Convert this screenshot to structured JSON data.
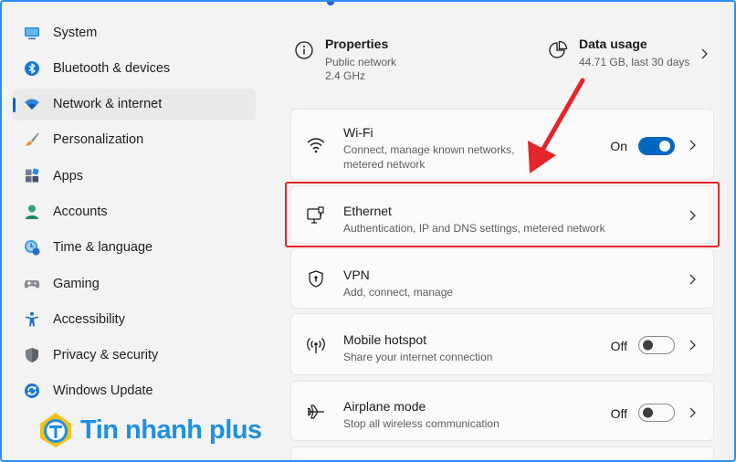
{
  "sidebar": {
    "items": [
      {
        "label": "System",
        "icon": "monitor-icon"
      },
      {
        "label": "Bluetooth & devices",
        "icon": "bluetooth-icon"
      },
      {
        "label": "Network & internet",
        "icon": "wifi-icon",
        "active": true
      },
      {
        "label": "Personalization",
        "icon": "brush-icon"
      },
      {
        "label": "Apps",
        "icon": "apps-icon"
      },
      {
        "label": "Accounts",
        "icon": "person-icon"
      },
      {
        "label": "Time & language",
        "icon": "clock-globe-icon"
      },
      {
        "label": "Gaming",
        "icon": "gamepad-icon"
      },
      {
        "label": "Accessibility",
        "icon": "accessibility-icon"
      },
      {
        "label": "Privacy & security",
        "icon": "shield-icon"
      },
      {
        "label": "Windows Update",
        "icon": "update-icon"
      }
    ]
  },
  "properties": {
    "title": "Properties",
    "line1": "Public network",
    "line2": "2.4 GHz"
  },
  "data_usage": {
    "title": "Data usage",
    "sub": "44.71 GB, last 30 days"
  },
  "cards": {
    "wifi": {
      "title": "Wi-Fi",
      "sub1": "Connect, manage known networks,",
      "sub2": "metered network",
      "state": "On",
      "toggle_on": true
    },
    "ethernet": {
      "title": "Ethernet",
      "sub": "Authentication, IP and DNS settings, metered network"
    },
    "vpn": {
      "title": "VPN",
      "sub": "Add, connect, manage"
    },
    "hotspot": {
      "title": "Mobile hotspot",
      "sub": "Share your internet connection",
      "state": "Off",
      "toggle_on": false
    },
    "airplane": {
      "title": "Airplane mode",
      "sub": "Stop all wireless communication",
      "state": "Off",
      "toggle_on": false
    }
  },
  "watermark": {
    "text": "Tin nhanh plus"
  },
  "colors": {
    "accent": "#0067c0",
    "highlight": "#e3262b",
    "arrow": "#e3262b",
    "logo": "#1f8fe0"
  }
}
